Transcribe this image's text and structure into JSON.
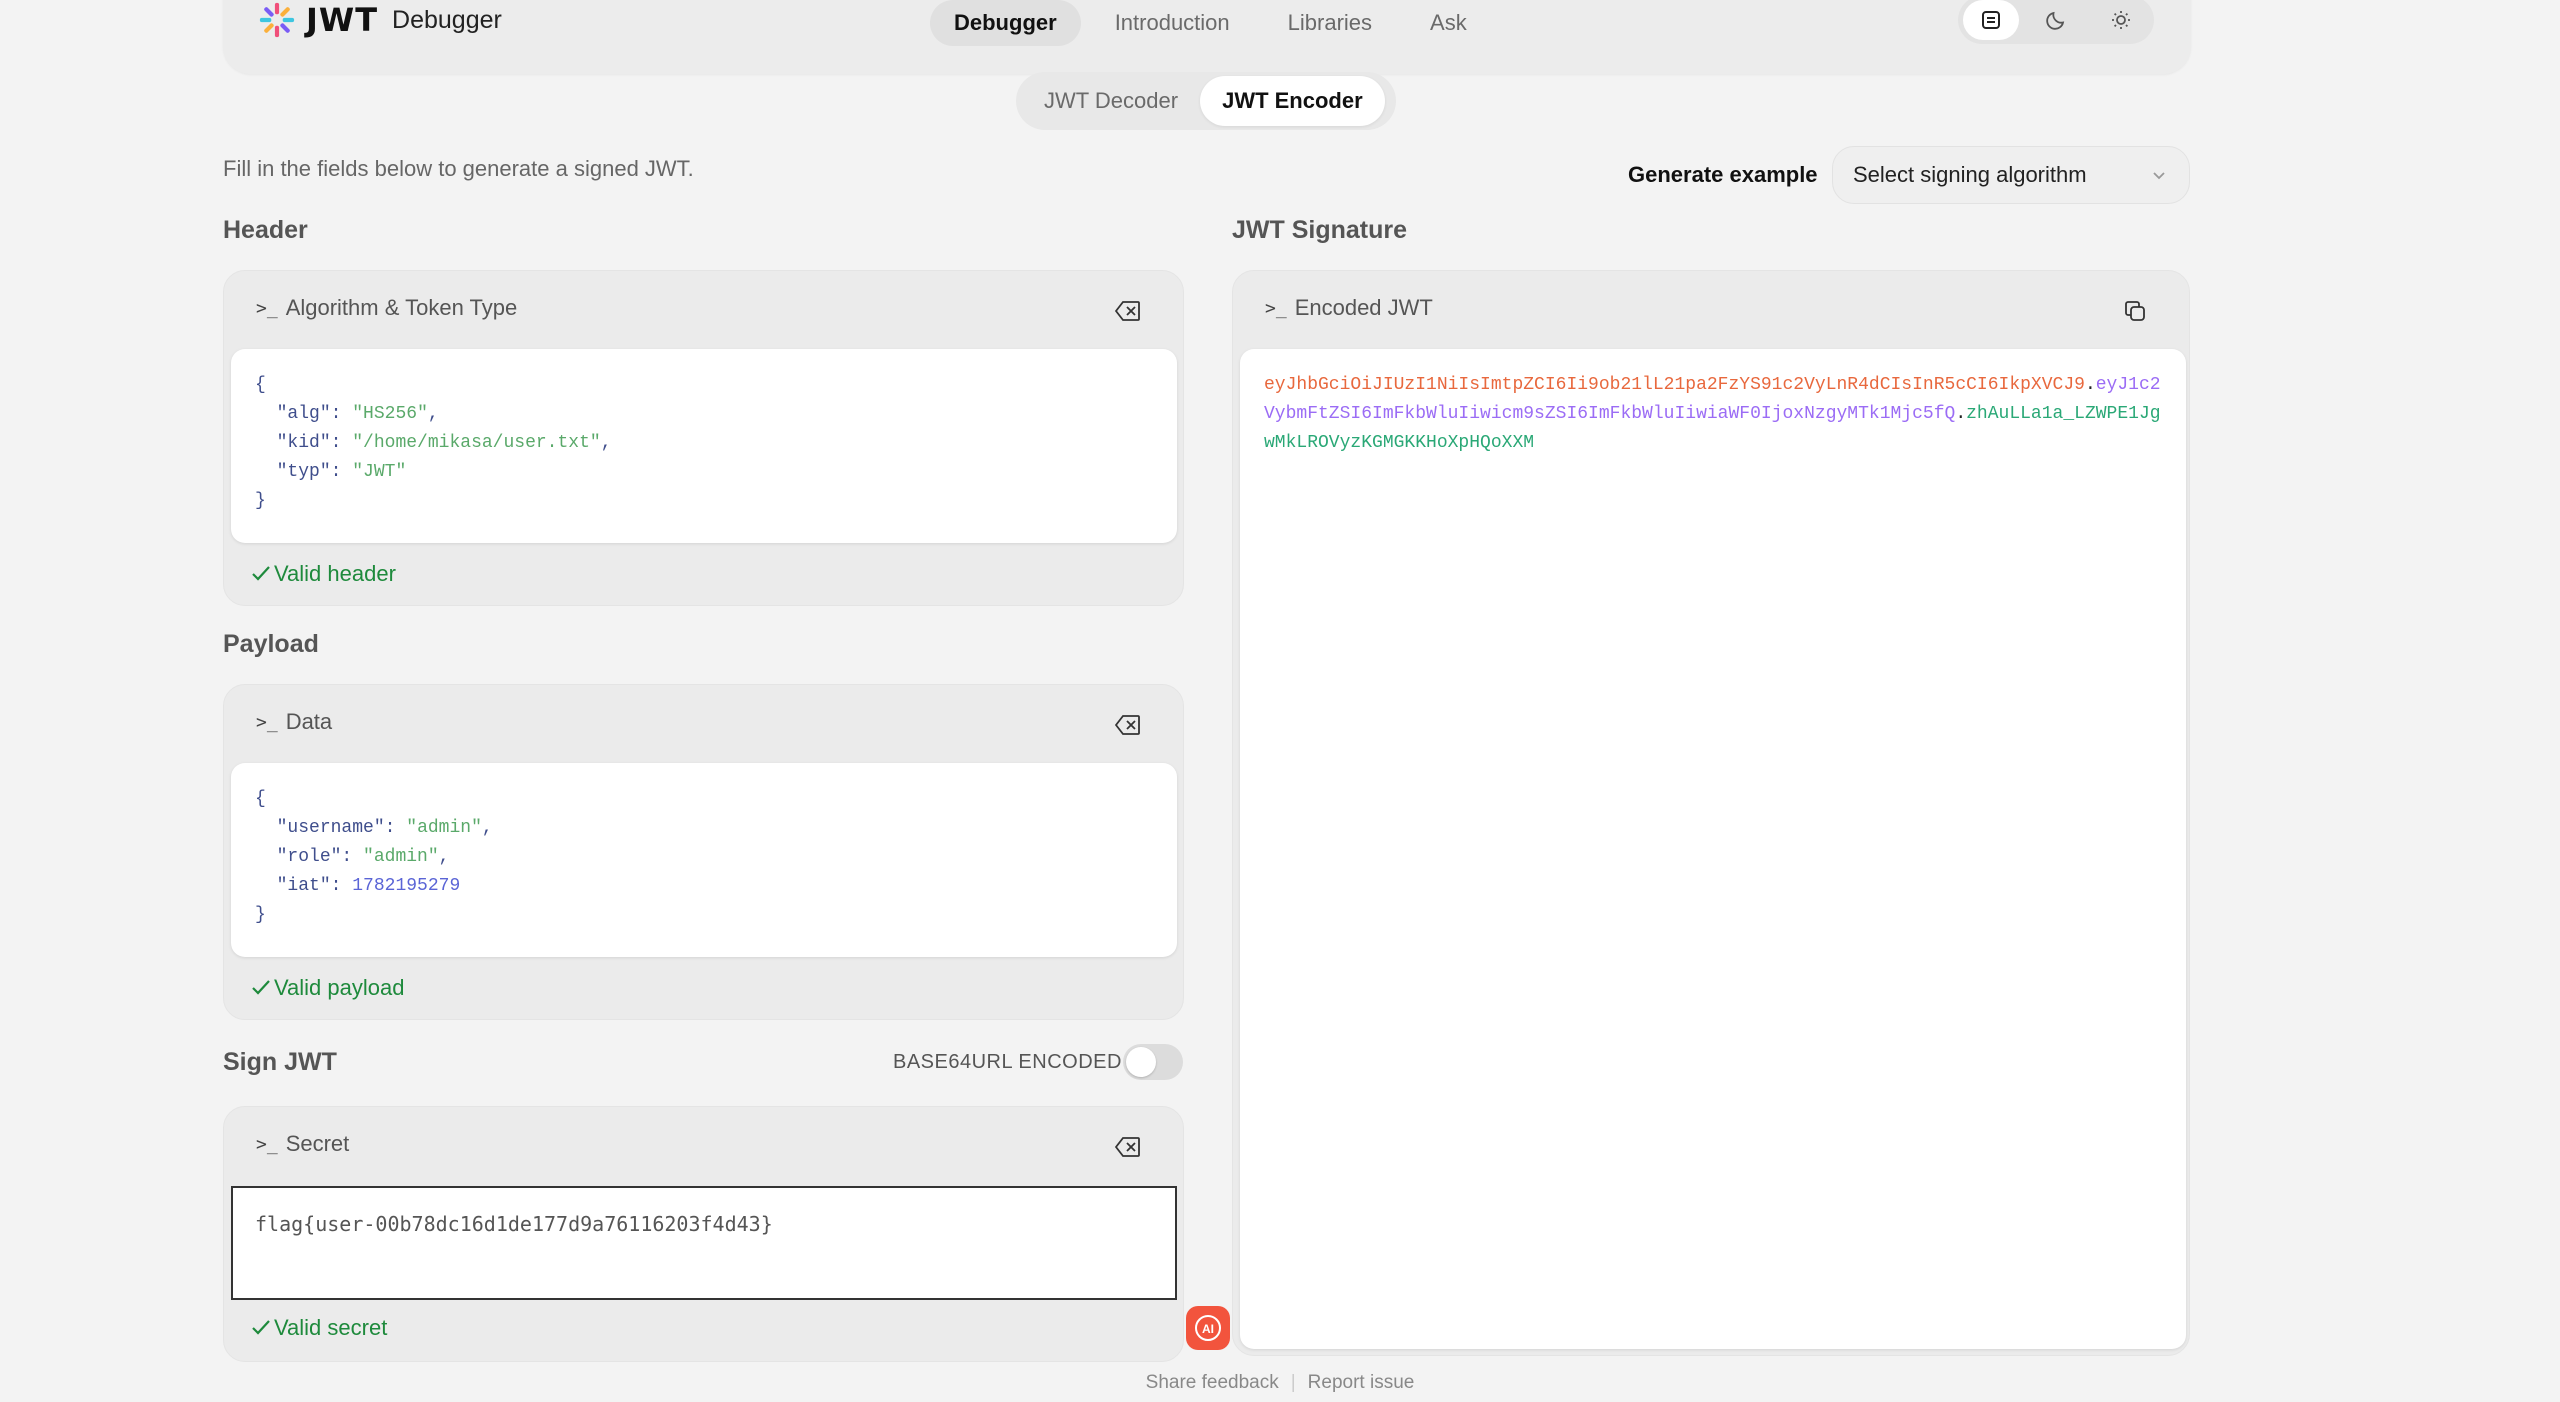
{
  "brand": {
    "logo_text": "JWT",
    "app_name": "Debugger"
  },
  "nav": {
    "items": [
      "Debugger",
      "Introduction",
      "Libraries",
      "Ask"
    ],
    "active": "Debugger"
  },
  "theme_switcher": {
    "icons": [
      "system-icon",
      "moon-icon",
      "sun-icon"
    ],
    "active": "system-icon"
  },
  "tabs": {
    "decoder": "JWT Decoder",
    "encoder": "JWT Encoder",
    "active": "JWT Encoder"
  },
  "intro_text": "Fill in the fields below to generate a signed JWT.",
  "generate": {
    "label": "Generate example",
    "select_value": "Select signing algorithm"
  },
  "header": {
    "section_title": "Header",
    "card_title": "Algorithm & Token Type",
    "prompt": ">_",
    "json": {
      "alg": "HS256",
      "kid": "/home/mikasa/user.txt",
      "typ": "JWT"
    },
    "valid": "Valid header"
  },
  "payload": {
    "section_title": "Payload",
    "card_title": "Data",
    "prompt": ">_",
    "json": {
      "username": "admin",
      "role": "admin",
      "iat": "1782195279"
    },
    "valid": "Valid payload"
  },
  "sign": {
    "section_title": "Sign JWT",
    "toggle_label": "BASE64URL ENCODED",
    "toggle_on": false,
    "card_title": "Secret",
    "prompt": ">_",
    "secret": "flag{user-00b78dc16d1de177d9a76116203f4d43}",
    "valid": "Valid secret"
  },
  "signature": {
    "section_title": "JWT Signature",
    "card_title": "Encoded JWT",
    "prompt": ">_",
    "jwt_header": "eyJhbGciOiJIUzI1NiIsImtpZCI6Ii9ob21lL21pa2FzYS91c2VyLnR4dCIsInR5cCI6IkpXVCJ9",
    "jwt_payload": "eyJ1c2VybmFtZSI6ImFkbWluIiwicm9sZSI6ImFkbWluIiwiaWF0IjoxNzgyMTk1Mjc5fQ",
    "jwt_signature": "zhAuLLa1a_LZWPE1JgwMkLROVyzKGMGKKHoXpHQoXXM",
    "dot": "."
  },
  "ai_button": "AI",
  "footer": {
    "share": "Share feedback",
    "sep": "|",
    "report": "Report issue"
  },
  "colors": {
    "accent_red": "#f2543d",
    "valid_green": "#1e8a3c",
    "jwt_header": "#e8683d",
    "jwt_payload": "#9b6cf5",
    "jwt_signature": "#2aa876"
  }
}
